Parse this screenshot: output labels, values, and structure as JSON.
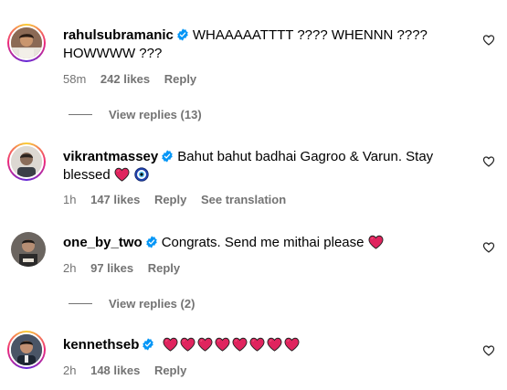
{
  "comments": [
    {
      "username": "rahulsubramanic",
      "text": "WHAAAAATTTT ???? WHENNN ???? HOWWWW ???",
      "time": "58m",
      "likes": "242 likes",
      "reply": "Reply",
      "view_replies": "View replies (13)"
    },
    {
      "username": "vikrantmassey",
      "text": "Bahut bahut badhai Gagroo & Varun. Stay blessed",
      "time": "1h",
      "likes": "147 likes",
      "reply": "Reply",
      "see_translation": "See translation"
    },
    {
      "username": "one_by_two",
      "text": "Congrats. Send me mithai please",
      "time": "2h",
      "likes": "97 likes",
      "reply": "Reply",
      "view_replies": "View replies (2)"
    },
    {
      "username": "kennethseb",
      "text": "",
      "time": "2h",
      "likes": "148 likes",
      "reply": "Reply"
    }
  ],
  "icons": {
    "verified": "verified-badge-icon",
    "like": "heart-outline-icon",
    "red_heart": "red-heart-emoji",
    "evil_eye": "nazar-amulet-emoji"
  },
  "colors": {
    "verified_blue": "#0095f6",
    "heart_red": "#e0245e",
    "muted": "#737373"
  }
}
